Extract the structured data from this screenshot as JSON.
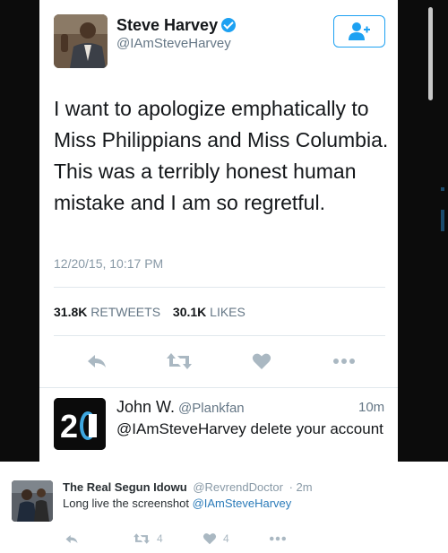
{
  "main_tweet": {
    "author_name": "Steve Harvey",
    "author_handle": "@IAmSteveHarvey",
    "verified": true,
    "text": "I want to apologize emphatically to Miss  Philippians and Miss Columbia. This was a terribly honest human mistake and I am so regretful.",
    "timestamp": "12/20/15, 10:17 PM",
    "retweets_count": "31.8K",
    "retweets_label": "RETWEETS",
    "likes_count": "30.1K",
    "likes_label": "LIKES",
    "follow_icon": "add-user-icon",
    "action_icons": [
      "reply-icon",
      "retweet-icon",
      "like-icon",
      "more-icon"
    ]
  },
  "reply": {
    "author_name": "John W.",
    "author_handle": "@Plankfan",
    "time": "10m",
    "text": "@IAmSteveHarvey delete your account",
    "avatar_text": "2"
  },
  "quote_tweet": {
    "author_name": "The Real Segun Idowu",
    "author_handle": "@RevrendDoctor",
    "separator": "·",
    "time": "2m",
    "text_prefix": "Long live the screenshot",
    "mention": "@IAmSteveHarvey",
    "retweets_count": "4",
    "likes_count": "4"
  },
  "colors": {
    "accent": "#1da1f2",
    "text": "#14171a",
    "muted": "#657786",
    "action_icon": "#aab8c2",
    "background_dark": "#0c0c0c"
  }
}
